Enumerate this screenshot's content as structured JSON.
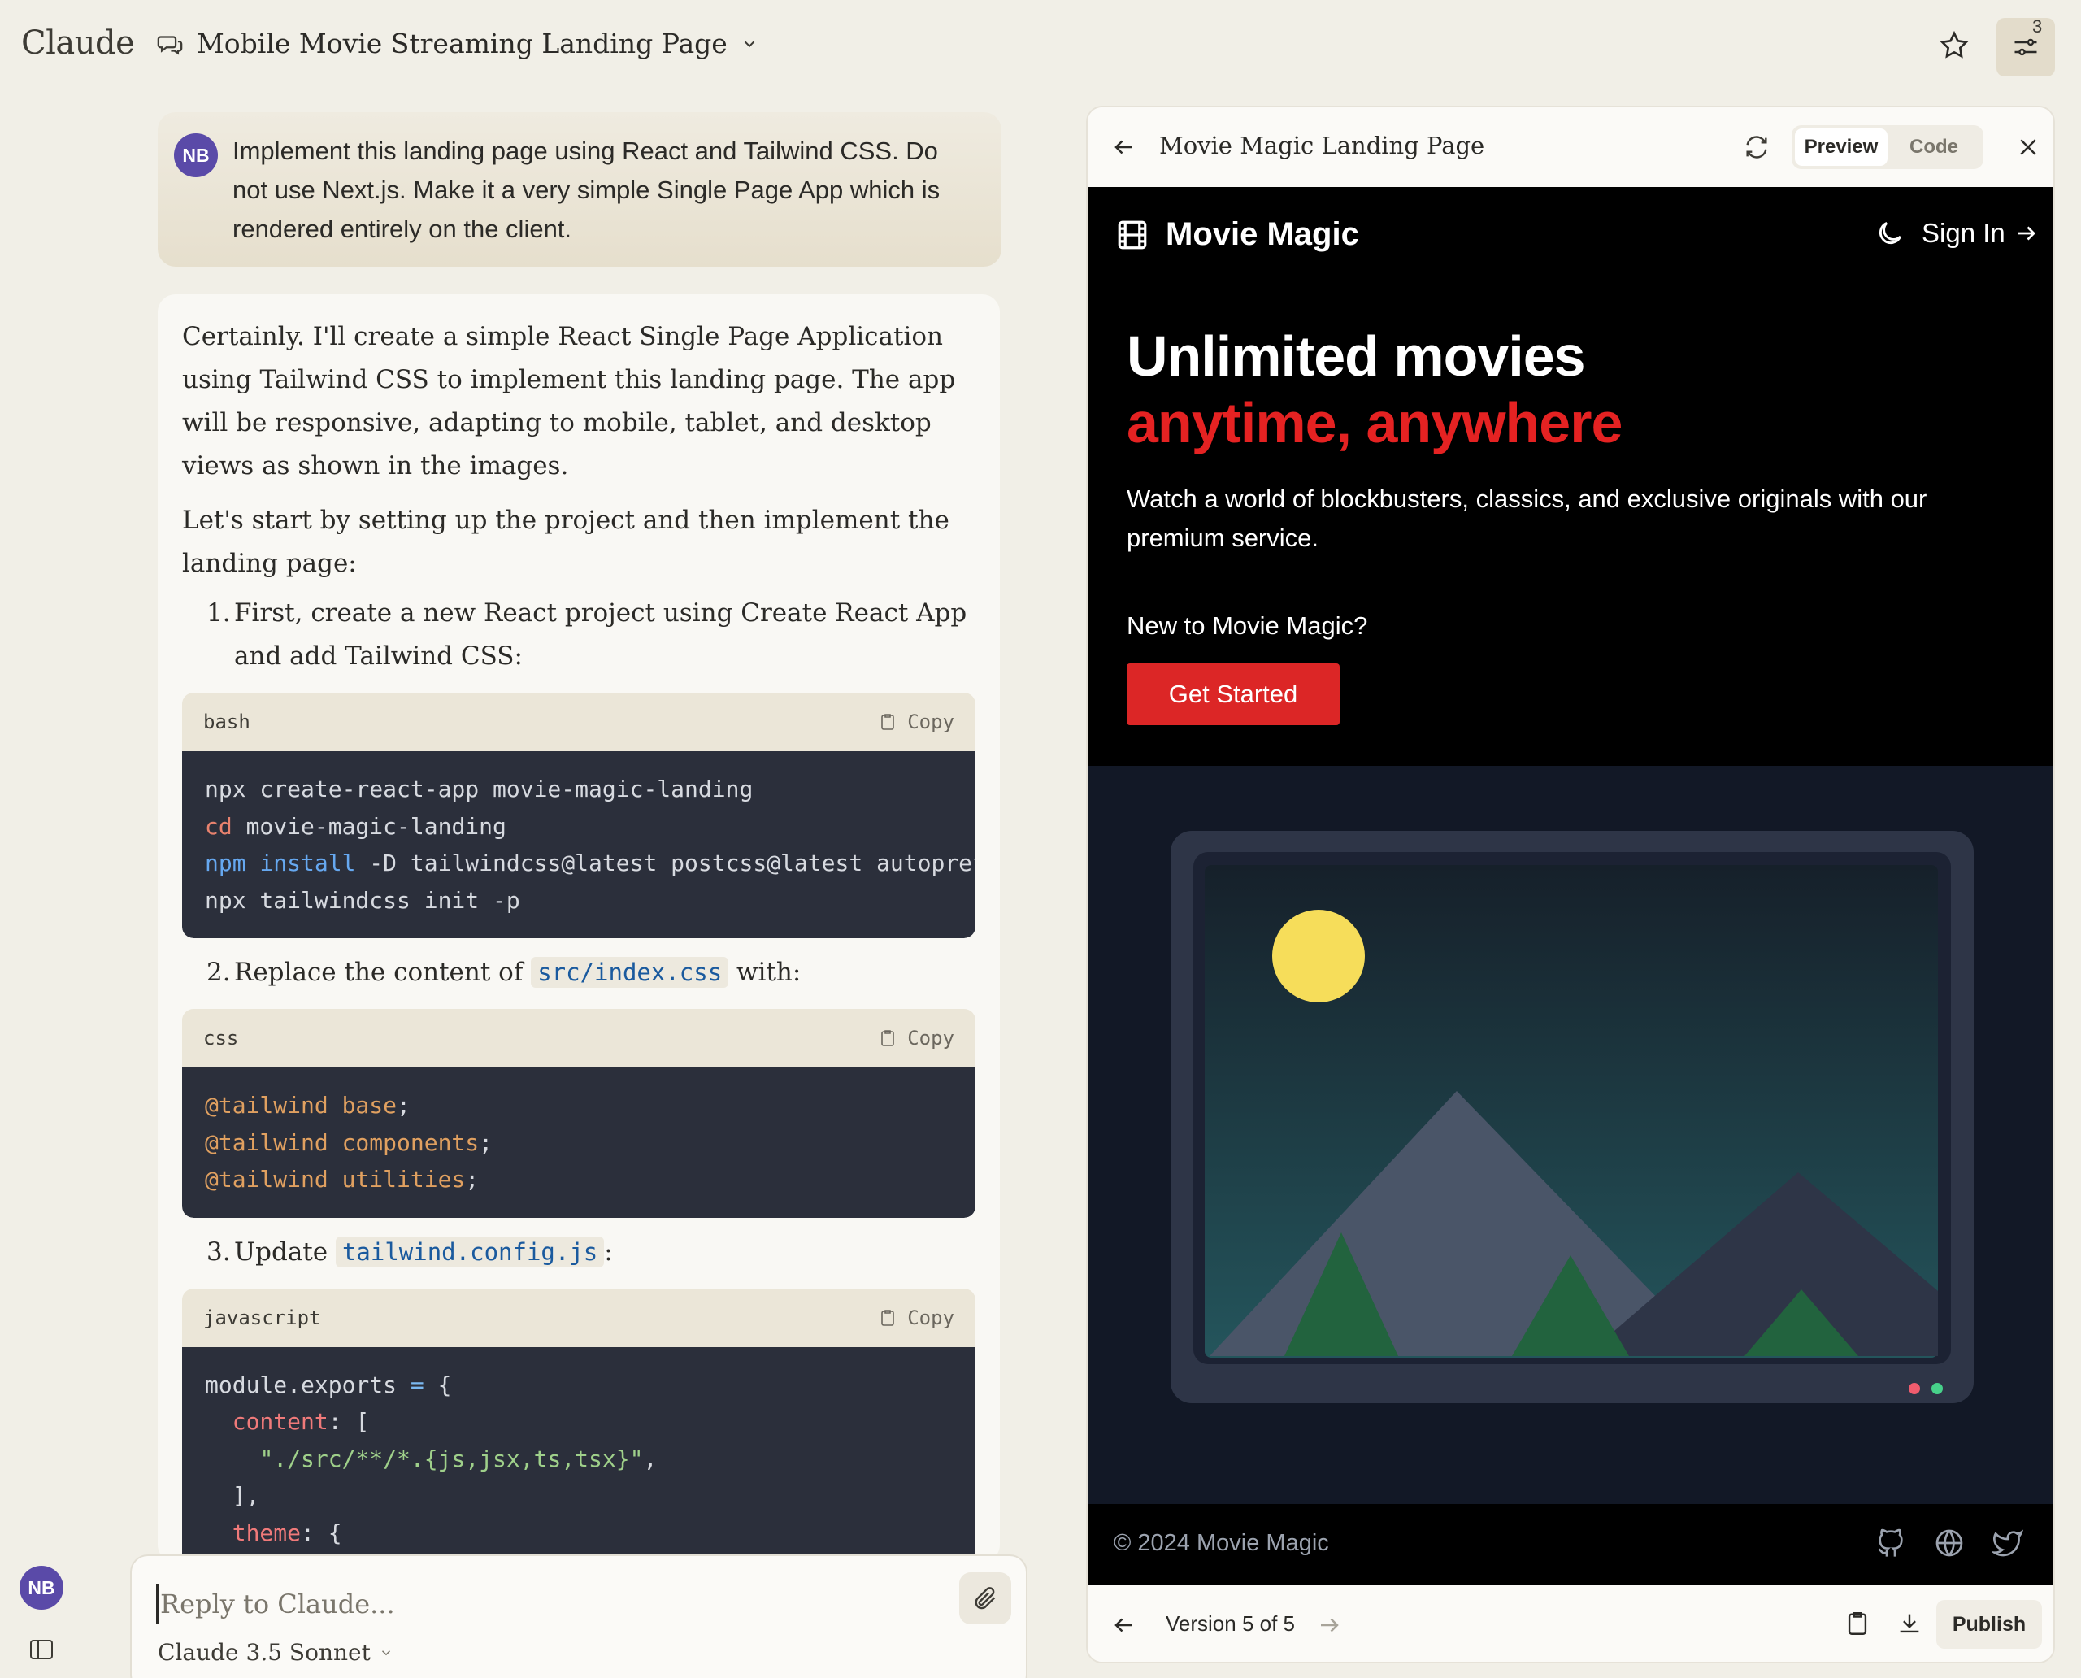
{
  "app": {
    "logo": "Claude"
  },
  "header": {
    "chat_title": "Mobile Movie Streaming Landing Page",
    "badge_count": "3"
  },
  "user": {
    "initials": "NB"
  },
  "user_message": "Implement this landing page using React and Tailwind CSS. Do not use Next.js. Make it a very simple Single Page App which is rendered entirely on the client.",
  "assistant": {
    "para1": "Certainly. I'll create a simple React Single Page Application using Tailwind CSS to implement this landing page. The app will be responsive, adapting to mobile, tablet, and desktop views as shown in the images.",
    "para2": "Let's start by setting up the project and then implement the landing page:",
    "step1_num": "1.",
    "step1_line1": "First, create a new React project using Create React App",
    "step1_line2": "and add Tailwind CSS:",
    "code1_lang": "bash",
    "copy_label": "Copy",
    "step2_num": "2.",
    "step2_pre": "Replace the content of ",
    "step2_code": "src/index.css",
    "step2_post": " with:",
    "code2_lang": "css",
    "step3_num": "3.",
    "step3_pre": "Update ",
    "step3_code": "tailwind.config.js",
    "step3_post": ":",
    "code3_lang": "javascript"
  },
  "reply": {
    "placeholder": "Reply to Claude...",
    "model": "Claude 3.5 Sonnet"
  },
  "artifact": {
    "title": "Movie Magic Landing Page",
    "tab_preview": "Preview",
    "tab_code": "Code",
    "version": "Version 5 of 5",
    "publish": "Publish"
  },
  "preview": {
    "brand": "Movie Magic",
    "sign_in": "Sign In",
    "hero_line1": "Unlimited movies",
    "hero_line2": "anytime, anywhere",
    "hero_sub": "Watch a world of blockbusters, classics, and exclusive originals with our premium service.",
    "new_to": "New to Movie Magic?",
    "cta": "Get Started",
    "copyright": "© 2024 Movie Magic"
  },
  "colors": {
    "accent_red": "#dc2626",
    "avatar_purple": "#5a4aa8",
    "code_bg": "#2b2f3b",
    "page_bg": "#f1efe7"
  },
  "icons": [
    "chat-bubbles-icon",
    "chevron-down-icon",
    "star-icon",
    "sliders-icon",
    "copy-icon",
    "paperclip-icon",
    "sidebar-toggle-icon",
    "arrow-left-icon",
    "refresh-icon",
    "close-icon",
    "film-icon",
    "moon-icon",
    "arrow-right-icon",
    "github-icon",
    "globe-icon",
    "twitter-icon",
    "clipboard-icon",
    "download-icon"
  ]
}
